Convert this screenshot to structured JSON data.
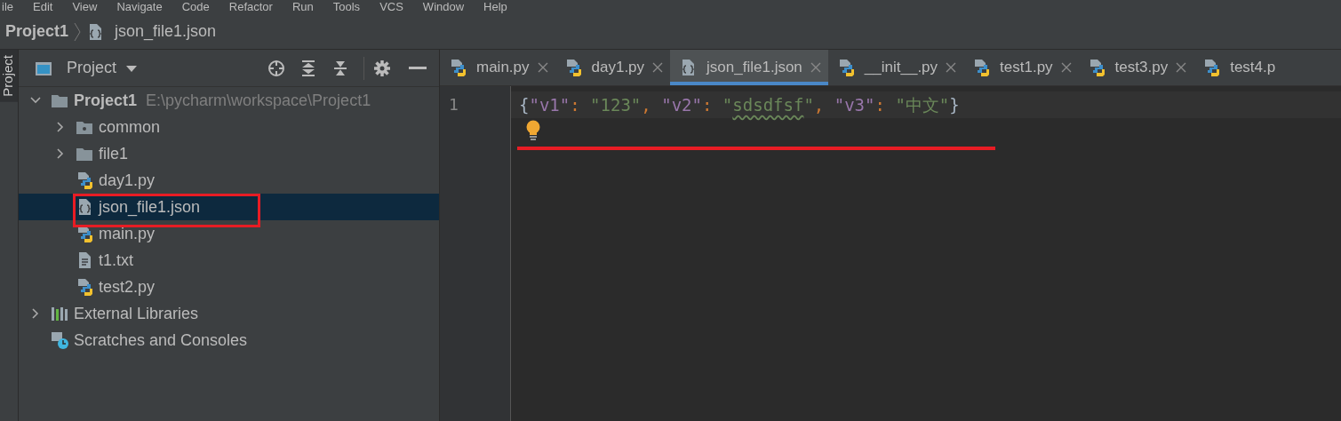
{
  "menu": [
    "ile",
    "Edit",
    "View",
    "Navigate",
    "Code",
    "Refactor",
    "Run",
    "Tools",
    "VCS",
    "Window",
    "Help"
  ],
  "breadcrumb": [
    {
      "label": "Project1",
      "kind": "project"
    },
    {
      "label": "json_file1.json",
      "kind": "json"
    }
  ],
  "side_stripe": [
    {
      "label": "Project",
      "selected": true
    }
  ],
  "project_panel": {
    "title": "Project",
    "tree": [
      {
        "label": "Project1",
        "path": "E:\\pycharm\\workspace\\Project1",
        "kind": "folder",
        "expanded": true,
        "selected": false,
        "children": [
          {
            "label": "common",
            "kind": "package",
            "expanded": false,
            "selected": false
          },
          {
            "label": "file1",
            "kind": "folder",
            "expanded": false,
            "selected": false
          },
          {
            "label": "day1.py",
            "kind": "python",
            "selected": false
          },
          {
            "label": "json_file1.json",
            "kind": "json",
            "selected": true
          },
          {
            "label": "main.py",
            "kind": "python",
            "selected": false
          },
          {
            "label": "t1.txt",
            "kind": "text",
            "selected": false
          },
          {
            "label": "test2.py",
            "kind": "python",
            "selected": false
          }
        ]
      },
      {
        "label": "External Libraries",
        "kind": "libraries",
        "expanded": false,
        "selected": false
      },
      {
        "label": "Scratches and Consoles",
        "kind": "scratches",
        "selected": false
      }
    ]
  },
  "editor": {
    "tabs": [
      {
        "label": "main.py",
        "kind": "python",
        "selected": false
      },
      {
        "label": "day1.py",
        "kind": "python",
        "selected": false
      },
      {
        "label": "json_file1.json",
        "kind": "json",
        "selected": true
      },
      {
        "label": "__init__.py",
        "kind": "python",
        "selected": false
      },
      {
        "label": "test1.py",
        "kind": "python",
        "selected": false
      },
      {
        "label": "test3.py",
        "kind": "python",
        "selected": false
      },
      {
        "label": "test4.p",
        "kind": "python",
        "selected": false
      }
    ],
    "lines": [
      {
        "number": "1",
        "tokens": [
          {
            "text": "{",
            "kind": "brace"
          },
          {
            "text": "\"v1\"",
            "kind": "key"
          },
          {
            "text": ": ",
            "kind": "punct"
          },
          {
            "text": "\"123\"",
            "kind": "string"
          },
          {
            "text": ", ",
            "kind": "punct"
          },
          {
            "text": "\"v2\"",
            "kind": "key"
          },
          {
            "text": ": ",
            "kind": "punct"
          },
          {
            "text": "\"",
            "kind": "string"
          },
          {
            "text": "sdsdfsf",
            "kind": "string",
            "typo": true
          },
          {
            "text": "\"",
            "kind": "string"
          },
          {
            "text": ", ",
            "kind": "punct"
          },
          {
            "text": "\"v3\"",
            "kind": "key"
          },
          {
            "text": ": ",
            "kind": "punct"
          },
          {
            "text": "\"中文\"",
            "kind": "string"
          },
          {
            "text": "}",
            "kind": "brace"
          }
        ]
      }
    ]
  }
}
